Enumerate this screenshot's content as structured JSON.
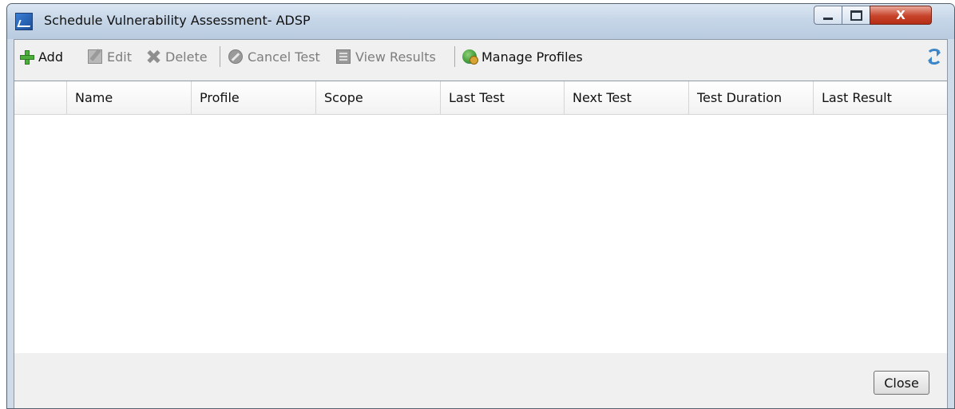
{
  "window": {
    "title": "Schedule Vulnerability Assessment- ADSP",
    "controls": {
      "minimize_icon": "minimize-icon",
      "maximize_icon": "maximize-icon",
      "close_label": "X"
    }
  },
  "toolbar": {
    "add": {
      "label": "Add",
      "icon": "plus-icon",
      "enabled": true
    },
    "edit": {
      "label": "Edit",
      "icon": "edit-icon",
      "enabled": false
    },
    "delete": {
      "label": "Delete",
      "icon": "delete-icon",
      "enabled": false
    },
    "cancel_test": {
      "label": "Cancel Test",
      "icon": "cancel-icon",
      "enabled": false
    },
    "view_results": {
      "label": "View Results",
      "icon": "view-results-icon",
      "enabled": false
    },
    "manage_profiles": {
      "label": "Manage Profiles",
      "icon": "profiles-icon",
      "enabled": true
    },
    "refresh_icon": "refresh-icon"
  },
  "table": {
    "columns": [
      "",
      "Name",
      "Profile",
      "Scope",
      "Last Test",
      "Next Test",
      "Test Duration",
      "Last Result"
    ],
    "rows": []
  },
  "footer": {
    "close_label": "Close"
  }
}
